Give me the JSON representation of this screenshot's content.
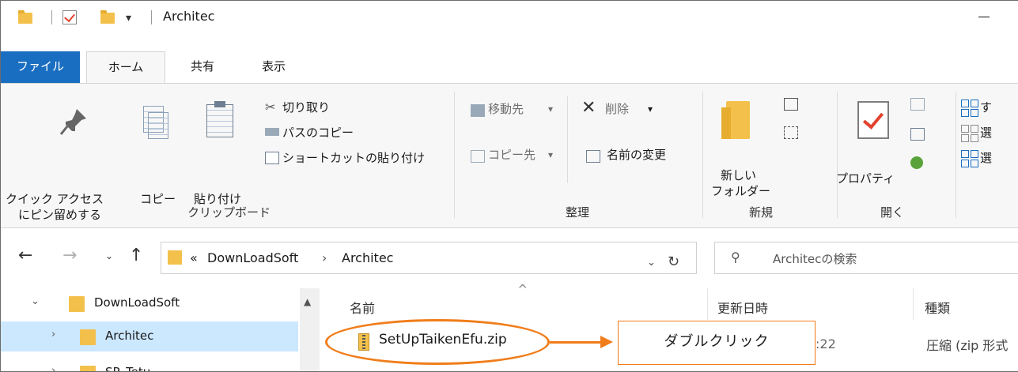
{
  "window": {
    "title": "Architec"
  },
  "title_bar": {
    "quick_access_dropdown": "▾",
    "minimize_glyph": "—"
  },
  "ribbon_tabs": [
    {
      "label": "ファイル"
    },
    {
      "label": "ホーム"
    },
    {
      "label": "共有"
    },
    {
      "label": "表示"
    }
  ],
  "clipboard": {
    "pin_label_1": "クイック アクセス",
    "pin_label_2": "にピン留めする",
    "copy": "コピー",
    "paste": "貼り付け",
    "cut": "切り取り",
    "copy_path": "パスのコピー",
    "paste_shortcut": "ショートカットの貼り付け",
    "group_label": "クリップボード"
  },
  "organize": {
    "move_to": "移動先",
    "copy_to": "コピー先",
    "delete": "削除",
    "rename": "名前の変更",
    "group_label": "整理",
    "dropdown": "▾"
  },
  "new": {
    "new_folder_1": "新しい",
    "new_folder_2": "フォルダー",
    "group_label": "新規"
  },
  "open": {
    "properties": "プロパティ",
    "group_label": "開く"
  },
  "select": {
    "select_all": "す",
    "select_none": "選",
    "invert": "選"
  },
  "address": {
    "overflow": "«",
    "crumb_1": "DownLoadSoft",
    "separator": "›",
    "crumb_2": "Architec"
  },
  "search": {
    "placeholder": "Architecの検索"
  },
  "nav_pane": {
    "items": [
      {
        "label": "DownLoadSoft"
      },
      {
        "label": "Architec"
      },
      {
        "label": "SP_Tetu"
      }
    ]
  },
  "file_list": {
    "columns": {
      "name": "名前",
      "modified": "更新日時",
      "type": "種類"
    },
    "rows": [
      {
        "name": "SetUpTaikenEfu.zip",
        "modified_partial": ":22",
        "type": "圧縮 (zip 形式"
      }
    ]
  },
  "annotation": {
    "callout": "ダブルクリック"
  },
  "colors": {
    "accent": "#1a6ec1",
    "annotation": "#f07d1a",
    "selection": "#cce8ff",
    "folder": "#f3c14b"
  }
}
